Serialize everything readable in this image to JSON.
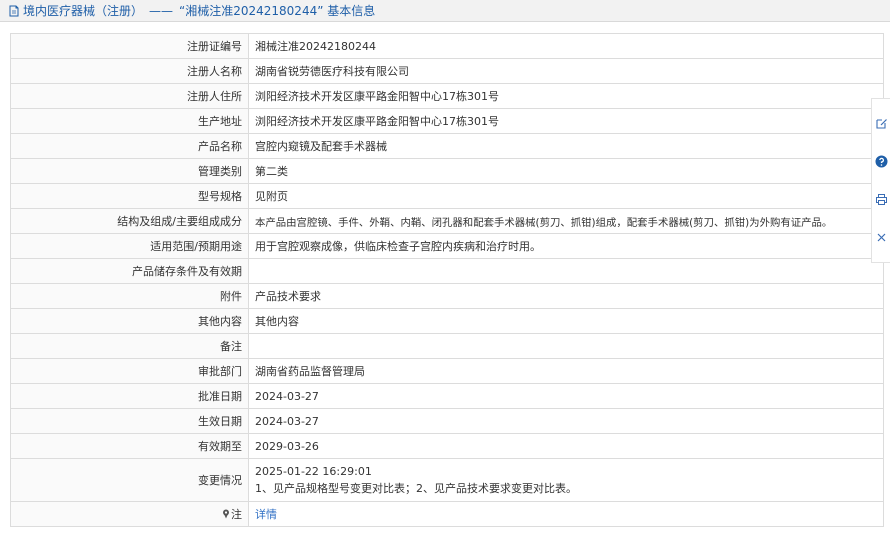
{
  "header": {
    "breadcrumb": "境内医疗器械（注册）",
    "separator": "——",
    "title": "“湘械注准20242180244” 基本信息"
  },
  "rows": [
    {
      "label": "注册证编号",
      "value": "湘械注准20242180244"
    },
    {
      "label": "注册人名称",
      "value": "湖南省锐劳德医疗科技有限公司"
    },
    {
      "label": "注册人住所",
      "value": "浏阳经济技术开发区康平路金阳智中心17栋301号"
    },
    {
      "label": "生产地址",
      "value": "浏阳经济技术开发区康平路金阳智中心17栋301号"
    },
    {
      "label": "产品名称",
      "value": "宫腔内窥镜及配套手术器械"
    },
    {
      "label": "管理类别",
      "value": "第二类"
    },
    {
      "label": "型号规格",
      "value": "见附页"
    },
    {
      "label": "结构及组成/主要组成成分",
      "value": "本产品由宫腔镜、手件、外鞘、内鞘、闭孔器和配套手术器械(剪刀、抓钳)组成，配套手术器械(剪刀、抓钳)为外购有证产品。"
    },
    {
      "label": "适用范围/预期用途",
      "value": "用于宫腔观察成像，供临床检查子宫腔内疾病和治疗时用。"
    },
    {
      "label": "产品储存条件及有效期",
      "value": ""
    },
    {
      "label": "附件",
      "value": "产品技术要求"
    },
    {
      "label": "其他内容",
      "value": "其他内容"
    },
    {
      "label": "备注",
      "value": ""
    },
    {
      "label": "审批部门",
      "value": "湖南省药品监督管理局"
    },
    {
      "label": "批准日期",
      "value": "2024-03-27"
    },
    {
      "label": "生效日期",
      "value": "2024-03-27"
    },
    {
      "label": "有效期至",
      "value": "2029-03-26"
    }
  ],
  "change": {
    "label": "变更情况",
    "date": "2025-01-22 16:29:01",
    "text": "1、见产品规格型号变更对比表；2、见产品技术要求变更对比表。"
  },
  "note": {
    "label": "注",
    "link": "详情"
  },
  "icons": {
    "header": "document-icon",
    "note": "pin-icon",
    "toolbar": [
      "edit-icon",
      "help-icon",
      "print-icon",
      "close-icon"
    ]
  },
  "colors": {
    "link": "#2f6fc4",
    "header_text": "#1f5fa8",
    "help_icon": "#1f5fa8"
  }
}
